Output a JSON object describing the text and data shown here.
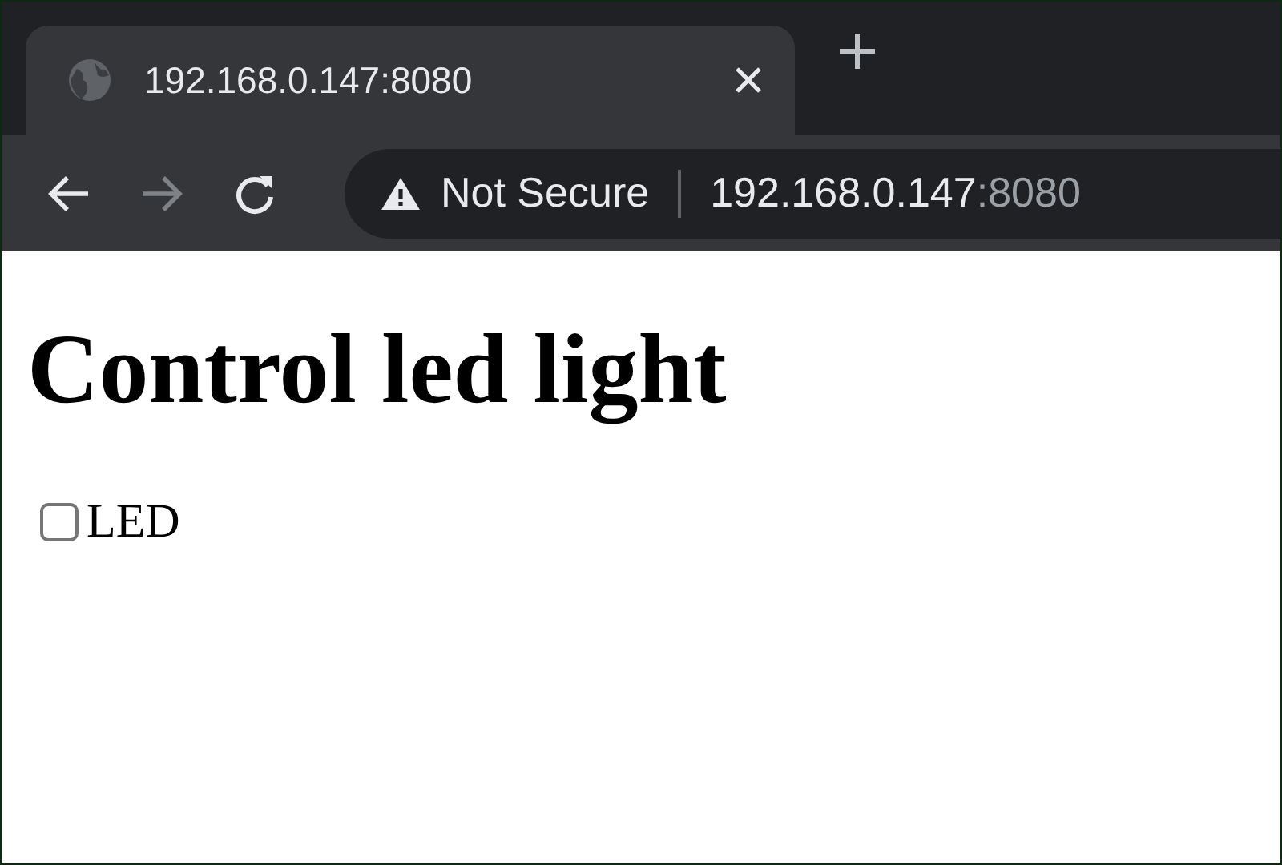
{
  "tabs": [
    {
      "title": "192.168.0.147:8080",
      "selected": true
    }
  ],
  "address_bar": {
    "security": "Not Secure",
    "host": "192.168.0.147",
    "port": ":8080"
  },
  "page": {
    "heading": "Control led light",
    "checkbox": {
      "label": "LED",
      "checked": false
    }
  }
}
